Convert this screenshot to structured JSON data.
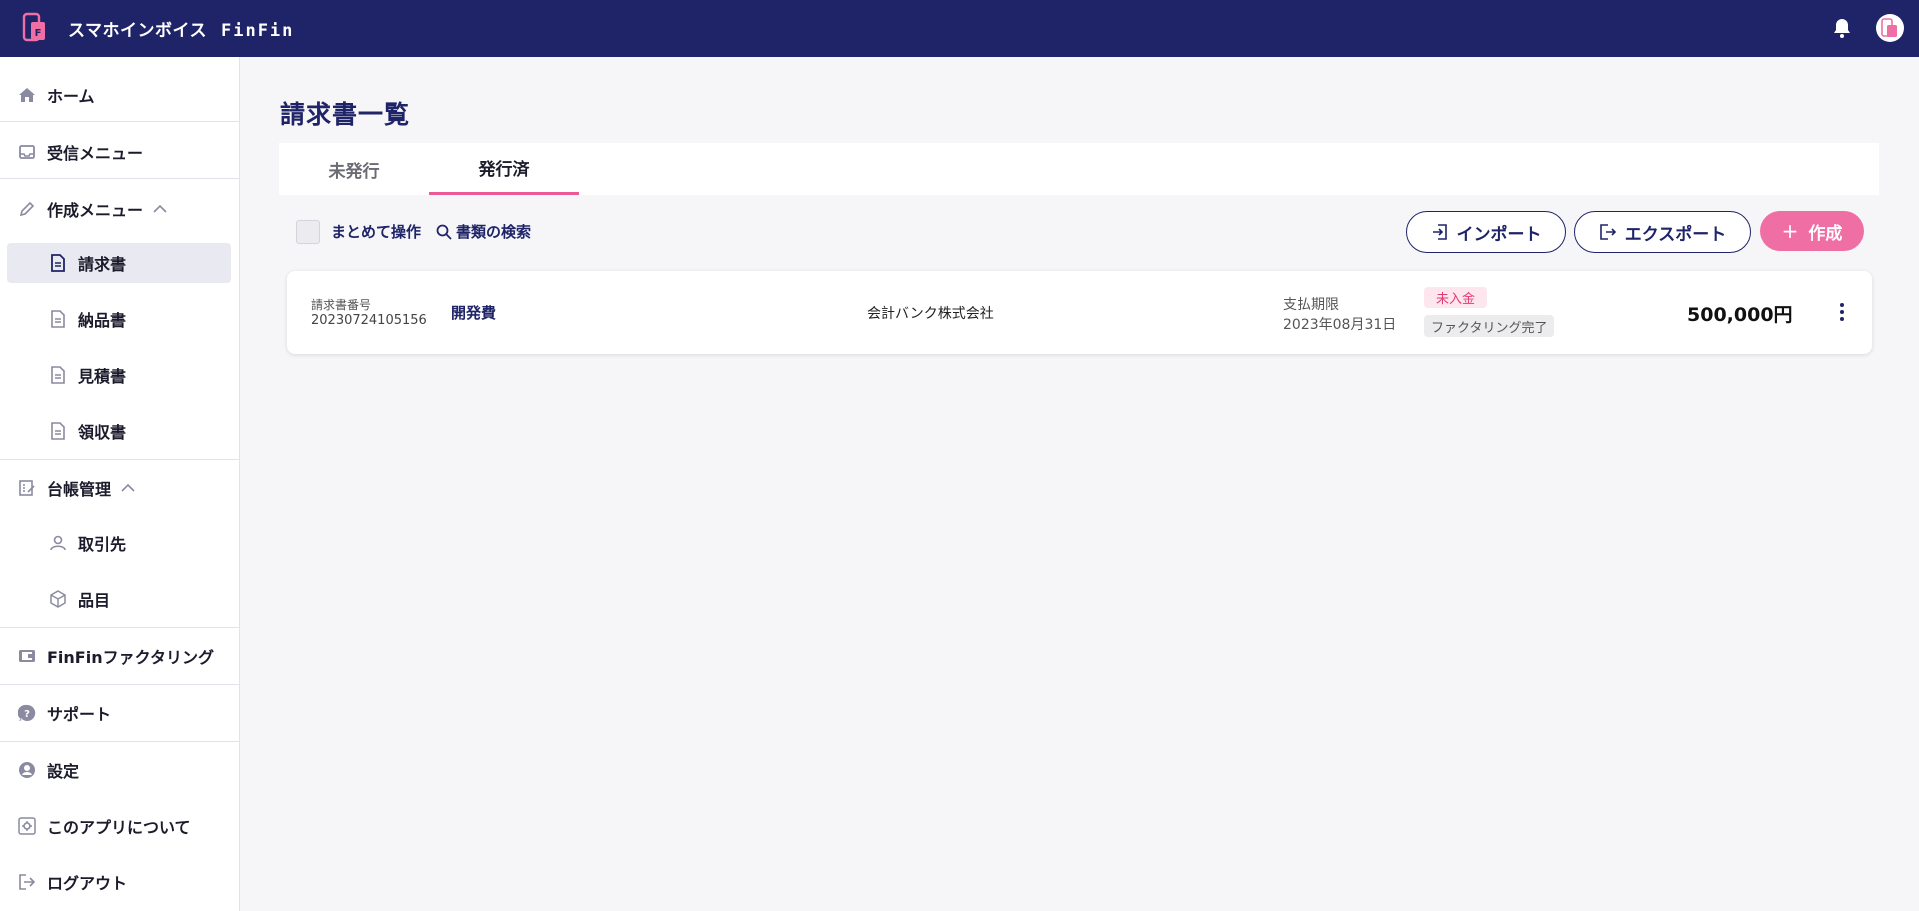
{
  "app": {
    "brand": "スマホインボイス",
    "product": "FinFin"
  },
  "colors": {
    "topbar": "#1f2468",
    "accent": "#ef6fa5",
    "navy": "#1f2468"
  },
  "sidebar": {
    "home": "ホーム",
    "receive_menu": "受信メニュー",
    "create_menu": "作成メニュー",
    "invoice": "請求書",
    "delivery": "納品書",
    "estimate": "見積書",
    "receipt": "領収書",
    "ledger": "台帳管理",
    "partners": "取引先",
    "items": "品目",
    "factoring": "FinFinファクタリング",
    "support": "サポート",
    "settings": "設定",
    "about": "このアプリについて",
    "logout": "ログアウト"
  },
  "main": {
    "title": "請求書一覧",
    "tabs": [
      {
        "label": "未発行"
      },
      {
        "label": "発行済"
      }
    ],
    "bulk_label": "まとめて操作",
    "search_label": "書類の検索",
    "import_label": "インポート",
    "export_label": "エクスポート",
    "create_label": "作成",
    "invoices": [
      {
        "number_label": "請求書番号",
        "number": "20230724105156",
        "subject": "開発費",
        "client": "会計バンク株式会社",
        "due_label": "支払期限",
        "due_date": "2023年08月31日",
        "status": "未入金",
        "factoring_status": "ファクタリング完了",
        "amount": "500,000円"
      }
    ]
  }
}
